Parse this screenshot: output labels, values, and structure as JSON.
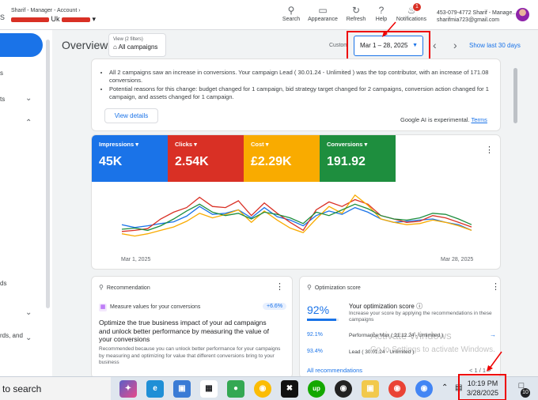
{
  "topbar": {
    "left_fragment": "s",
    "account_line1": "Sharif - Manager - Account",
    "account_line2_suffix": "Uk",
    "tools": [
      {
        "name": "search-icon",
        "label": "Search",
        "glyph": "⚲"
      },
      {
        "name": "appearance-icon",
        "label": "Appearance",
        "glyph": "▭"
      },
      {
        "name": "refresh-icon",
        "label": "Refresh",
        "glyph": "↻"
      },
      {
        "name": "help-icon",
        "label": "Help",
        "glyph": "?"
      },
      {
        "name": "bell-icon",
        "label": "Notifications",
        "glyph": "🔔"
      }
    ],
    "notification_count": "1",
    "user_line1": "453-079-4772 Sharif - Manage...",
    "user_line2": "sharifmia723@gmail.com"
  },
  "sidebar": {
    "fragments": [
      "s",
      "ts",
      "ds",
      "rds, and"
    ]
  },
  "header": {
    "title": "Overview",
    "view_filters": "View (2 filters)",
    "view_value": "All campaigns",
    "custom_label": "Custom",
    "date_range": "Mar 1 – 28, 2025",
    "show_last": "Show last 30 days"
  },
  "ai_card": {
    "bullet1": "All 2 campaigns saw an increase in conversions. Your campaign Lead ( 30.01.24 - Unlimited ) was the top contributor, with an increase of 171.08 conversions.",
    "bullet2": "Potential reasons for this change: budget changed for 1 campaign, bid strategy target changed for 2 campaigns, conversion action changed for 1 campaign, and assets changed for 1 campaign.",
    "view_details": "View details",
    "note": "Google AI is experimental.",
    "terms": "Terms"
  },
  "metrics": [
    {
      "label": "Impressions ▾",
      "value": "45K",
      "color": "#1a73e8"
    },
    {
      "label": "Clicks ▾",
      "value": "2.54K",
      "color": "#d93025"
    },
    {
      "label": "Cost ▾",
      "value": "£2.29K",
      "color": "#f9ab00"
    },
    {
      "label": "Conversions ▾",
      "value": "191.92",
      "color": "#1e8e3e"
    }
  ],
  "chart_data": {
    "type": "line",
    "x_start": "Mar 1, 2025",
    "x_end": "Mar 28, 2025",
    "series": [
      {
        "color": "#1a73e8",
        "values": [
          40,
          35,
          38,
          42,
          45,
          55,
          72,
          58,
          60,
          66,
          52,
          70,
          54,
          48,
          38,
          56,
          64,
          58,
          70,
          62,
          50,
          44,
          46,
          48,
          50,
          44,
          40,
          30
        ]
      },
      {
        "color": "#d93025",
        "values": [
          28,
          30,
          33,
          50,
          62,
          70,
          88,
          72,
          70,
          82,
          56,
          78,
          60,
          44,
          30,
          66,
          80,
          72,
          84,
          76,
          56,
          50,
          44,
          46,
          56,
          52,
          44,
          36
        ]
      },
      {
        "color": "#f9ab00",
        "values": [
          24,
          20,
          24,
          30,
          36,
          46,
          60,
          52,
          58,
          66,
          44,
          64,
          48,
          34,
          26,
          50,
          72,
          60,
          92,
          74,
          50,
          44,
          40,
          42,
          48,
          44,
          38,
          30
        ]
      },
      {
        "color": "#1e8e3e",
        "values": [
          32,
          34,
          30,
          38,
          50,
          64,
          76,
          62,
          56,
          60,
          50,
          62,
          58,
          52,
          42,
          62,
          56,
          66,
          76,
          68,
          56,
          50,
          48,
          52,
          60,
          58,
          50,
          40
        ]
      }
    ],
    "ylim": [
      0,
      100
    ]
  },
  "recommendation": {
    "header": "Recommendation",
    "sub": "Measure values for your conversions",
    "badge": "+6.6%",
    "title": "Optimize the true business impact of your ad campaigns and unlock better performance by measuring the value of your conversions",
    "desc": "Recommended because you can unlock better performance for your campaigns by measuring and optimizing for value that different conversions bring to your business"
  },
  "optimization": {
    "header": "Optimization score",
    "score": "92%",
    "score_fraction": 0.92,
    "title": "Your optimization score",
    "desc": "Increase your score by applying the recommendations in these campaigns",
    "rows": [
      {
        "pct": "92.1%",
        "name": "Performance Max ( 21.12.24 - Unlimited )"
      },
      {
        "pct": "93.4%",
        "name": "Lead ( 30.01.24 - Unlimited )"
      }
    ],
    "all_recs": "All recommendations",
    "pager": "< 1 / 1 >"
  },
  "watermark": {
    "line1": "Activate Windows",
    "line2": "Go to Settings to activate Windows."
  },
  "taskbar": {
    "search": "to search",
    "time": "10:19 PM",
    "date": "3/28/2025",
    "notif_count": "10"
  }
}
